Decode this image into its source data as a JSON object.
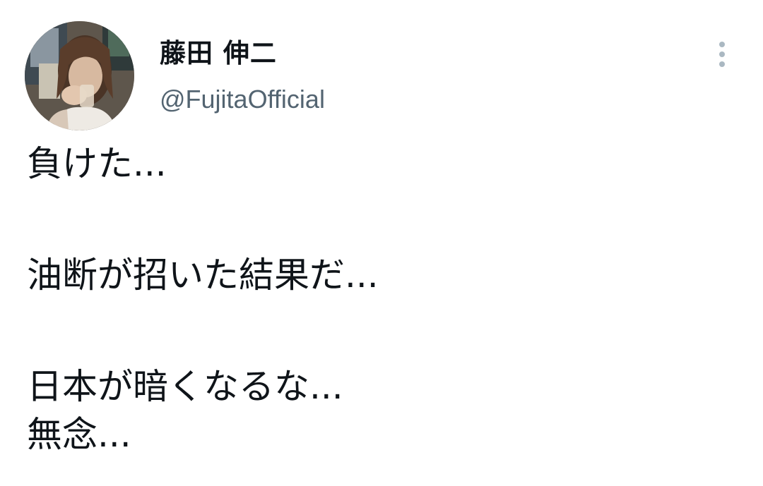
{
  "author": {
    "display_name": "藤田 伸二",
    "handle": "@FujitaOfficial"
  },
  "icons": {
    "more": "more-vertical-icon",
    "avatar": "profile-photo"
  },
  "tweet": {
    "lines": [
      "負けた...",
      "油断が招いた結果だ...",
      "日本が暗くなるな...",
      "無念..."
    ]
  },
  "colors": {
    "text": "#0f1419",
    "secondary_text": "#536471",
    "more_dots": "#aab8c2",
    "background": "#ffffff"
  }
}
